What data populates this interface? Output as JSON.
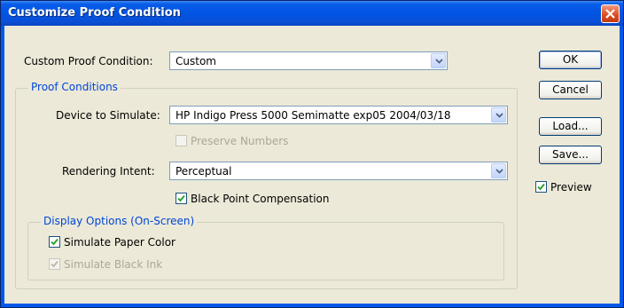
{
  "window": {
    "title": "Customize Proof Condition"
  },
  "custom_proof_condition": {
    "label": "Custom Proof Condition:",
    "value": "Custom"
  },
  "proof_conditions": {
    "legend": "Proof Conditions",
    "device_label": "Device to Simulate:",
    "device_value": "HP Indigo Press 5000 Semimatte exp05 2004/03/18",
    "preserve_numbers": {
      "label": "Preserve Numbers",
      "checked": false,
      "enabled": false
    },
    "rendering_label": "Rendering Intent:",
    "rendering_value": "Perceptual",
    "black_point": {
      "label": "Black Point Compensation",
      "checked": true,
      "enabled": true
    }
  },
  "display_options": {
    "legend": "Display Options (On-Screen)",
    "paper_color": {
      "label": "Simulate Paper Color",
      "checked": true,
      "enabled": true
    },
    "black_ink": {
      "label": "Simulate Black Ink",
      "checked": true,
      "enabled": false
    }
  },
  "buttons": {
    "ok": "OK",
    "cancel": "Cancel",
    "load": "Load...",
    "save": "Save..."
  },
  "preview": {
    "label": "Preview",
    "checked": true
  },
  "colors": {
    "title_bar": "#0054e3",
    "dialog_bg": "#ece9d8",
    "group_legend": "#0046d5",
    "close_button": "#d94a20"
  },
  "icons": {
    "close": "close-icon",
    "dropdown": "chevron-down-icon",
    "check": "checkmark-icon"
  }
}
